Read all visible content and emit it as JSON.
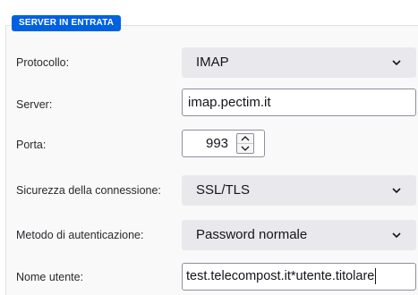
{
  "section": {
    "title": "SERVER IN ENTRATA"
  },
  "fields": {
    "protocol": {
      "label": "Protocollo:",
      "value": "IMAP"
    },
    "server": {
      "label": "Server:",
      "value": "imap.pectim.it"
    },
    "port": {
      "label": "Porta:",
      "value": "993"
    },
    "security": {
      "label": "Sicurezza della connessione:",
      "value": "SSL/TLS"
    },
    "auth": {
      "label": "Metodo di autenticazione:",
      "value": "Password normale"
    },
    "username": {
      "label": "Nome utente:",
      "value": "test.telecompost.it*utente.titolare"
    }
  },
  "colors": {
    "accent": "#0061e0",
    "panel_bg": "#f9f9fa",
    "select_bg": "#e9e9ed"
  },
  "icons": {
    "dropdown": "chevron-down-icon",
    "spinner_up": "chevron-up-icon",
    "spinner_down": "chevron-down-icon"
  }
}
